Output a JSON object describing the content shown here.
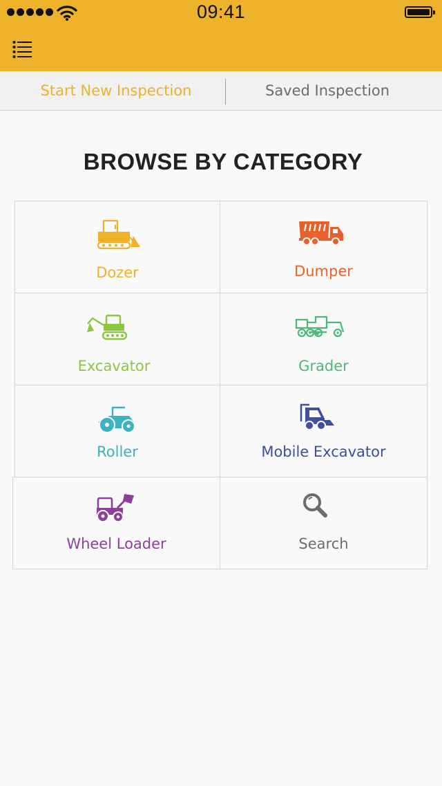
{
  "status_bar": {
    "time": "09:41"
  },
  "tabs": {
    "start_new": "Start New Inspection",
    "saved": "Saved Inspection"
  },
  "heading": "BROWSE BY CATEGORY",
  "categories": [
    {
      "label": "Dozer",
      "icon": "dozer-icon",
      "color": "#edb12a"
    },
    {
      "label": "Dumper",
      "icon": "dumper-icon",
      "color": "#e8612a"
    },
    {
      "label": "Excavator",
      "icon": "excavator-icon",
      "color": "#8cc63f"
    },
    {
      "label": "Grader",
      "icon": "grader-icon",
      "color": "#4cb87a"
    },
    {
      "label": "Roller",
      "icon": "roller-icon",
      "color": "#3bb3c3"
    },
    {
      "label": "Mobile Excavator",
      "icon": "mobile-excavator-icon",
      "color": "#3e4f9c"
    },
    {
      "label": "Wheel Loader",
      "icon": "wheel-loader-icon",
      "color": "#8e3f9b"
    },
    {
      "label": "Search",
      "icon": "search-icon",
      "color": "#6c6c6c"
    }
  ]
}
